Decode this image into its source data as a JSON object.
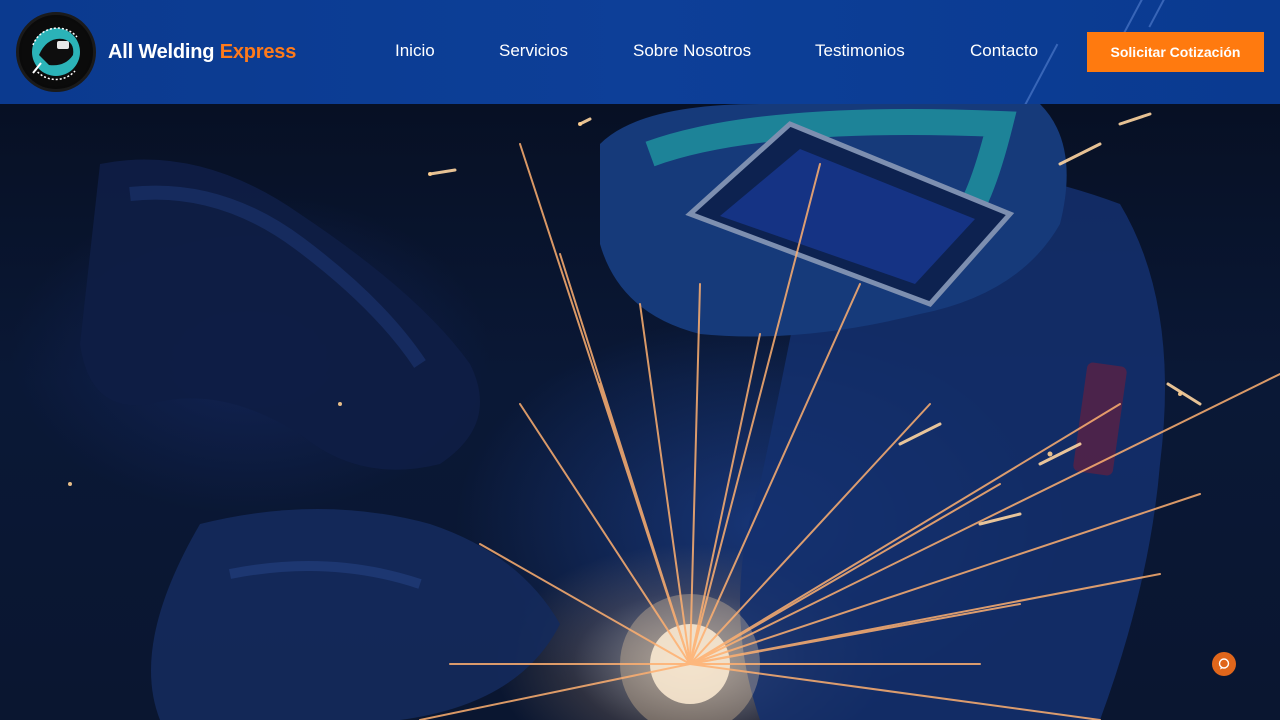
{
  "header": {
    "brand": {
      "name_main": "All Welding",
      "name_accent": "Express",
      "logo_icon": "welder-logo-icon"
    },
    "nav": {
      "items": [
        {
          "label": "Inicio"
        },
        {
          "label": "Servicios"
        },
        {
          "label": "Sobre Nosotros"
        },
        {
          "label": "Testimonios"
        },
        {
          "label": "Contacto"
        }
      ]
    },
    "cta": {
      "label": "Solicitar Cotización"
    }
  },
  "hero": {
    "background": "welding-sparks-photo"
  },
  "widgets": {
    "chat_icon": "chat-bubble-icon"
  },
  "colors": {
    "nav_bg": "#0d3f98",
    "accent_orange": "#ff7a0f",
    "text_white": "#ffffff"
  }
}
